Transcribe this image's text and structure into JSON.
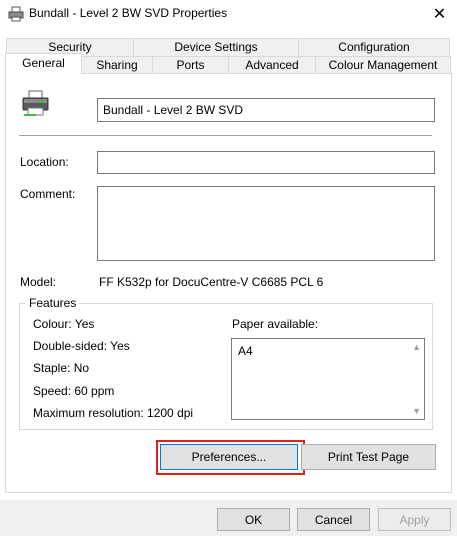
{
  "window": {
    "title": "Bundall - Level 2 BW SVD Properties",
    "close_glyph": "✕"
  },
  "tabs": {
    "row1": [
      "Security",
      "Device Settings",
      "Configuration"
    ],
    "row2": [
      "General",
      "Sharing",
      "Ports",
      "Advanced",
      "Colour Management"
    ],
    "active": "General"
  },
  "general": {
    "printer_name": "Bundall - Level 2 BW SVD",
    "location_label": "Location:",
    "location_value": "",
    "comment_label": "Comment:",
    "comment_value": "",
    "model_label": "Model:",
    "model_value": "FF K532p for DocuCentre-V C6685 PCL 6"
  },
  "features": {
    "legend": "Features",
    "colour": "Colour: Yes",
    "double_sided": "Double-sided: Yes",
    "staple": "Staple: No",
    "speed": "Speed: 60 ppm",
    "max_resolution": "Maximum resolution: 1200 dpi",
    "paper_available_label": "Paper available:",
    "paper_sizes": [
      "A4"
    ]
  },
  "buttons": {
    "preferences": "Preferences...",
    "print_test_page": "Print Test Page",
    "ok": "OK",
    "cancel": "Cancel",
    "apply": "Apply"
  },
  "icons": {
    "title": "printer-icon",
    "printer_large": "printer-icon",
    "scroll_up": "chevron-up-icon",
    "scroll_down": "chevron-down-icon"
  },
  "colors": {
    "highlight_border": "#e0201b",
    "focus_border": "#0078d7"
  }
}
